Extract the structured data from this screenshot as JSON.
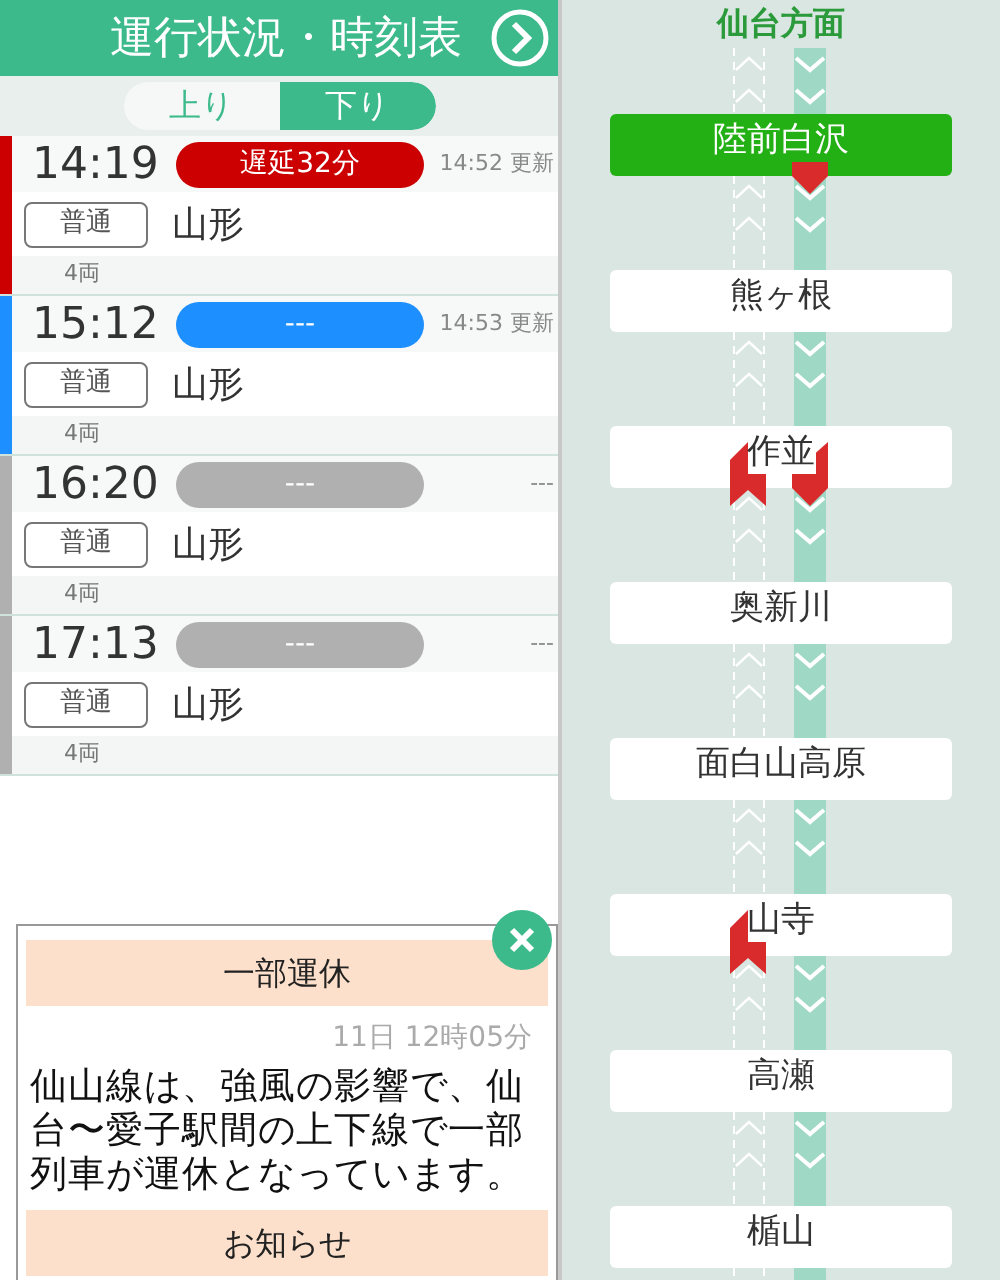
{
  "header": {
    "title": "運行状況・時刻表"
  },
  "tabs": [
    {
      "label": "上り",
      "selected": false
    },
    {
      "label": "下り",
      "selected": true
    }
  ],
  "trains": [
    {
      "time": "14:19",
      "status": "遅延32分",
      "color": "#cc0000",
      "updated": "14:52 更新",
      "type": "普通",
      "destination": "山形",
      "cars": "4両"
    },
    {
      "time": "15:12",
      "status": "---",
      "color": "#1e8fff",
      "updated": "14:53 更新",
      "type": "普通",
      "destination": "山形",
      "cars": "4両"
    },
    {
      "time": "16:20",
      "status": "---",
      "color": "#b0b0b0",
      "updated": "---",
      "type": "普通",
      "destination": "山形",
      "cars": "4両"
    },
    {
      "time": "17:13",
      "status": "---",
      "color": "#b0b0b0",
      "updated": "---",
      "type": "普通",
      "destination": "山形",
      "cars": "4両"
    }
  ],
  "notice": {
    "title": "一部運休",
    "date": "11日 12時05分",
    "message": "仙山線は、強風の影響で、仙台〜愛子駅間の上下線で一部列車が運休となっています。",
    "next_title": "お知らせ"
  },
  "route": {
    "direction": "仙台方面",
    "stations": [
      {
        "name": "陸前白沢",
        "selected": true,
        "train_up": false,
        "train_down": true
      },
      {
        "name": "熊ヶ根",
        "selected": false,
        "train_up": false,
        "train_down": false
      },
      {
        "name": "作並",
        "selected": false,
        "train_up": true,
        "train_down": true
      },
      {
        "name": "奥新川",
        "selected": false,
        "train_up": false,
        "train_down": false
      },
      {
        "name": "面白山高原",
        "selected": false,
        "train_up": false,
        "train_down": false
      },
      {
        "name": "山寺",
        "selected": false,
        "train_up": true,
        "train_down": false
      },
      {
        "name": "高瀬",
        "selected": false,
        "train_up": false,
        "train_down": false
      },
      {
        "name": "楯山",
        "selected": false,
        "train_up": false,
        "train_down": false
      }
    ]
  }
}
